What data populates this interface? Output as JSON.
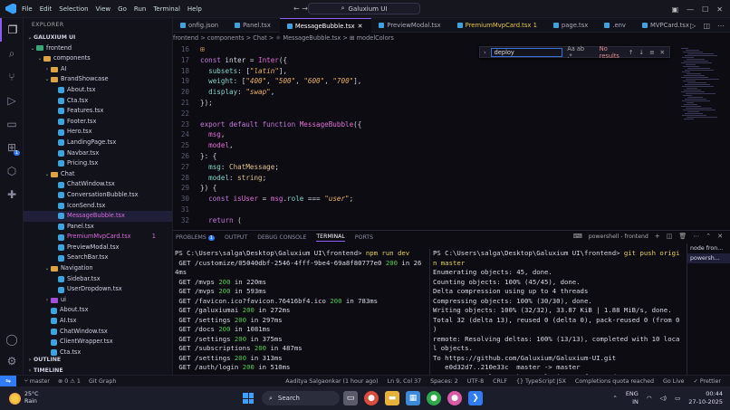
{
  "menu": [
    "File",
    "Edit",
    "Selection",
    "View",
    "Go",
    "Run",
    "Terminal",
    "Help"
  ],
  "title": "Galuxium UI",
  "sidebar": {
    "header": "EXPLORER",
    "root": "GALUXIUM UI",
    "items": [
      {
        "label": "frontend",
        "kind": "folder",
        "indent": 1,
        "open": true,
        "color": "g"
      },
      {
        "label": "components",
        "kind": "folder",
        "indent": 2,
        "open": true,
        "color": "y"
      },
      {
        "label": "AI",
        "kind": "folder",
        "indent": 3,
        "open": false,
        "color": "y"
      },
      {
        "label": "BrandShowcase",
        "kind": "folder",
        "indent": 3,
        "open": true,
        "color": "y"
      },
      {
        "label": "About.tsx",
        "kind": "file",
        "indent": 4
      },
      {
        "label": "Cta.tsx",
        "kind": "file",
        "indent": 4
      },
      {
        "label": "Features.tsx",
        "kind": "file",
        "indent": 4
      },
      {
        "label": "Footer.tsx",
        "kind": "file",
        "indent": 4
      },
      {
        "label": "Hero.tsx",
        "kind": "file",
        "indent": 4
      },
      {
        "label": "LandingPage.tsx",
        "kind": "file",
        "indent": 4
      },
      {
        "label": "Navbar.tsx",
        "kind": "file",
        "indent": 4
      },
      {
        "label": "Pricing.tsx",
        "kind": "file",
        "indent": 4
      },
      {
        "label": "Chat",
        "kind": "folder",
        "indent": 3,
        "open": true,
        "color": "y"
      },
      {
        "label": "ChatWindow.tsx",
        "kind": "file",
        "indent": 4
      },
      {
        "label": "ConversationBubble.tsx",
        "kind": "file",
        "indent": 4
      },
      {
        "label": "IconSend.tsx",
        "kind": "file",
        "indent": 4
      },
      {
        "label": "MessageBubble.tsx",
        "kind": "file",
        "indent": 4,
        "selected": true,
        "pink": true
      },
      {
        "label": "Panel.tsx",
        "kind": "file",
        "indent": 4
      },
      {
        "label": "PremiumMvpCard.tsx",
        "kind": "file",
        "indent": 4,
        "pink": true,
        "count": "1"
      },
      {
        "label": "PreviewModal.tsx",
        "kind": "file",
        "indent": 4
      },
      {
        "label": "SearchBar.tsx",
        "kind": "file",
        "indent": 4
      },
      {
        "label": "Navigation",
        "kind": "folder",
        "indent": 3,
        "open": true,
        "color": "y"
      },
      {
        "label": "Sidebar.tsx",
        "kind": "file",
        "indent": 4
      },
      {
        "label": "UserDropdown.tsx",
        "kind": "file",
        "indent": 4
      },
      {
        "label": "ui",
        "kind": "folder",
        "indent": 3,
        "open": false,
        "color": "p"
      },
      {
        "label": "About.tsx",
        "kind": "file",
        "indent": 3
      },
      {
        "label": "AI.tsx",
        "kind": "file",
        "indent": 3
      },
      {
        "label": "ChatWindow.tsx",
        "kind": "file",
        "indent": 3
      },
      {
        "label": "ClientWrapper.tsx",
        "kind": "file",
        "indent": 3
      },
      {
        "label": "Cta.tsx",
        "kind": "file",
        "indent": 3
      }
    ],
    "outline": "OUTLINE",
    "timeline": "TIMELINE"
  },
  "tabs": [
    {
      "label": "onfig.json",
      "active": false
    },
    {
      "label": "Panel.tsx",
      "active": false
    },
    {
      "label": "MessageBubble.tsx",
      "active": true
    },
    {
      "label": "PreviewModal.tsx",
      "active": false
    },
    {
      "label": "PremiumMvpCard.tsx 1",
      "active": false,
      "mod": true
    },
    {
      "label": "page.tsx",
      "active": false
    },
    {
      "label": ".env",
      "active": false
    },
    {
      "label": "MVPCard.tsx",
      "active": false
    }
  ],
  "breadcrumb": "frontend > components > Chat > ⚛ MessageBubble.tsx > ⊞ modelColors",
  "find": {
    "value": "deploy",
    "options": "Aa  ab  .*",
    "result": "No results"
  },
  "panel": {
    "tabs": [
      {
        "label": "PROBLEMS",
        "badge": "1"
      },
      {
        "label": "OUTPUT"
      },
      {
        "label": "DEBUG CONSOLE"
      },
      {
        "label": "TERMINAL",
        "active": true
      },
      {
        "label": "PORTS"
      }
    ],
    "shell_label": "powershell - frontend",
    "terminal_list": [
      "node  fron...",
      "powersh..."
    ]
  },
  "status": {
    "branch": "master",
    "problems": "⊗ 0 ⚠ 1",
    "graph": "Git Graph",
    "blame": "Aaditya Salgaonkar (1 hour ago)",
    "cursor": "Ln 9, Col 37",
    "spaces": "Spaces: 2",
    "encoding": "UTF-8",
    "eol": "CRLF",
    "lang": "{} TypeScript JSX",
    "completions": "Completions quota reached",
    "golive": "Go Live",
    "prettier": "✓ Prettier"
  },
  "taskbar": {
    "temp": "25°C",
    "cond": "Rain",
    "search": "Search",
    "lang": "ENG",
    "lang2": "IN",
    "time": "00:44",
    "date": "27-10-2025"
  }
}
